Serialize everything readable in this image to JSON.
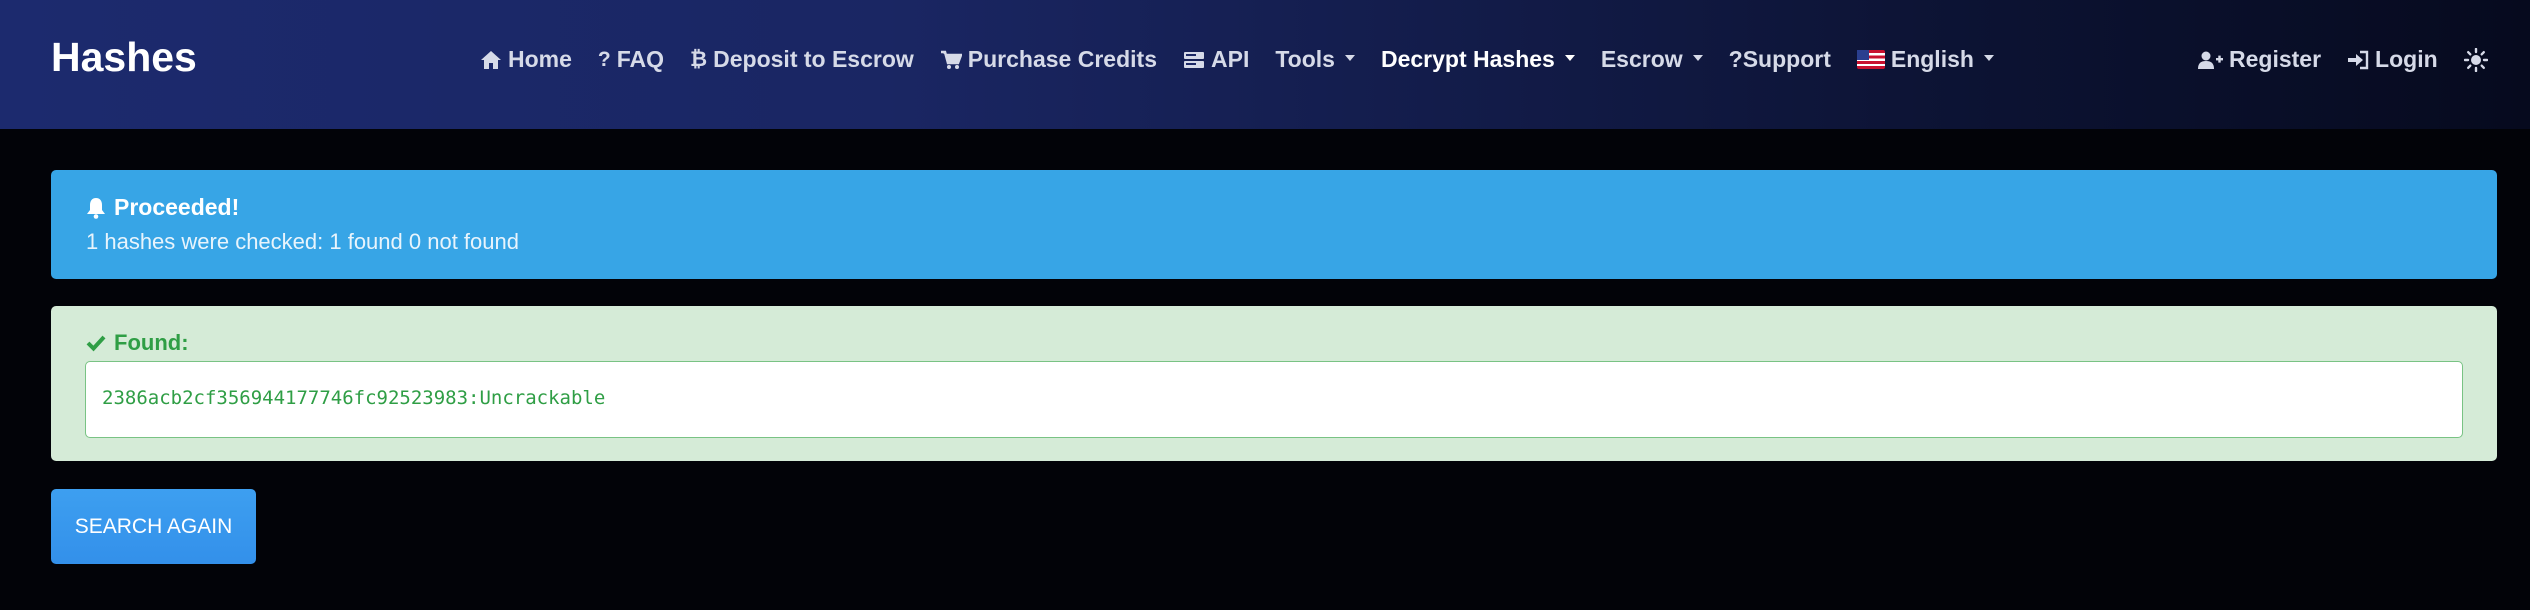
{
  "brand": "Hashes",
  "nav": {
    "home": "Home",
    "faq": "FAQ",
    "deposit": "Deposit to Escrow",
    "purchase": "Purchase Credits",
    "api": "API",
    "tools": "Tools",
    "decrypt": "Decrypt Hashes",
    "escrow": "Escrow",
    "support": "?Support",
    "language": "English",
    "register": "Register",
    "login": "Login"
  },
  "alert_info": {
    "title": "Proceeded!",
    "text": "1 hashes were checked: 1 found 0 not found"
  },
  "alert_success": {
    "title": "Found:",
    "result": "2386acb2cf356944177746fc92523983:Uncrackable"
  },
  "search_again_label": "SEARCH AGAIN",
  "colors": {
    "info": "#37a5e6",
    "success_bg": "#d5ebd7",
    "success_text": "#2f9e45",
    "button": "#3a9aee"
  }
}
